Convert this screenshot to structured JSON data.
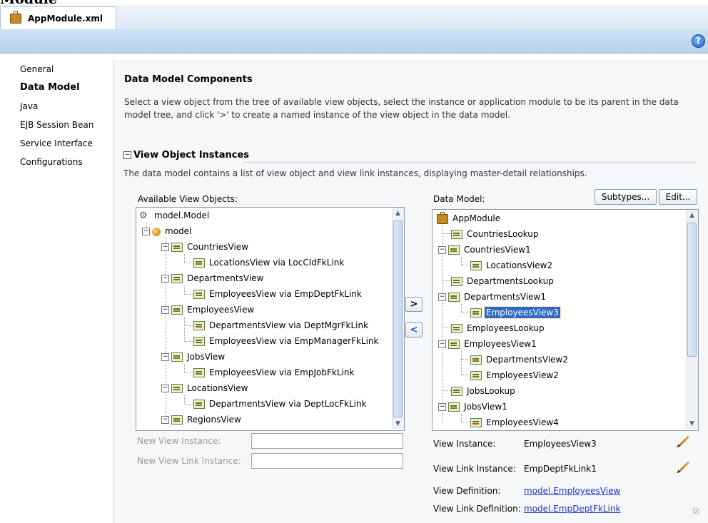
{
  "window": {
    "title_fragment": "Module"
  },
  "editor_tab": {
    "label": "AppModule.xml"
  },
  "toolbar": {
    "help_glyph": "?"
  },
  "nav": [
    {
      "label": "General"
    },
    {
      "label": "Data Model"
    },
    {
      "label": "Java"
    },
    {
      "label": "EJB Session Bean"
    },
    {
      "label": "Service Interface"
    },
    {
      "label": "Configurations"
    }
  ],
  "header": {
    "title": "Data Model Components",
    "description": "Select a view object from the tree of available view objects, select the instance or application module to be its parent in the data model tree, and click '>' to create a named instance of the view object in the data model."
  },
  "section": {
    "title": "View Object Instances",
    "description": "The data model contains a list of view object and view link instances, displaying master-detail relationships."
  },
  "available": {
    "label": "Available View Objects:",
    "items": [
      {
        "label": "model.Model",
        "icon": "gears-icon"
      },
      {
        "label": "model",
        "icon": "package-icon"
      },
      {
        "label": "CountriesView",
        "icon": "view-object-icon"
      },
      {
        "label": "LocationsView via LocCIdFkLink",
        "icon": "view-object-icon"
      },
      {
        "label": "DepartmentsView",
        "icon": "view-object-icon"
      },
      {
        "label": "EmployeesView via EmpDeptFkLink",
        "icon": "view-object-icon"
      },
      {
        "label": "EmployeesView",
        "icon": "view-object-icon"
      },
      {
        "label": "DepartmentsView via DeptMgrFkLink",
        "icon": "view-object-icon"
      },
      {
        "label": "EmployeesView via EmpManagerFkLink",
        "icon": "view-object-icon"
      },
      {
        "label": "JobsView",
        "icon": "view-object-icon"
      },
      {
        "label": "EmployeesView via EmpJobFkLink",
        "icon": "view-object-icon"
      },
      {
        "label": "LocationsView",
        "icon": "view-object-icon"
      },
      {
        "label": "DepartmentsView via DeptLocFkLink",
        "icon": "view-object-icon"
      },
      {
        "label": "RegionsView",
        "icon": "view-object-icon"
      }
    ]
  },
  "shuttle": {
    "add_label": ">",
    "remove_label": "<"
  },
  "datamodel": {
    "label": "Data Model:",
    "subtypes_button": "Subtypes...",
    "edit_button": "Edit...",
    "selected": "EmployeesView3",
    "items": [
      {
        "label": "AppModule",
        "icon": "app-module-icon"
      },
      {
        "label": "CountriesLookup",
        "icon": "view-instance-icon"
      },
      {
        "label": "CountriesView1",
        "icon": "view-instance-icon"
      },
      {
        "label": "LocationsView2",
        "icon": "view-instance-icon"
      },
      {
        "label": "DepartmentsLookup",
        "icon": "view-instance-icon"
      },
      {
        "label": "DepartmentsView1",
        "icon": "view-instance-icon"
      },
      {
        "label": "EmployeesView3",
        "icon": "view-instance-icon"
      },
      {
        "label": "EmployeesLookup",
        "icon": "view-instance-icon"
      },
      {
        "label": "EmployeesView1",
        "icon": "view-instance-icon"
      },
      {
        "label": "DepartmentsView2",
        "icon": "view-instance-icon"
      },
      {
        "label": "EmployeesView2",
        "icon": "view-instance-icon"
      },
      {
        "label": "JobsLookup",
        "icon": "view-instance-icon"
      },
      {
        "label": "JobsView1",
        "icon": "view-instance-icon"
      },
      {
        "label": "EmployeesView4",
        "icon": "view-instance-icon"
      }
    ]
  },
  "fields": {
    "new_view_instance_label": "New View Instance:",
    "new_view_instance_value": "",
    "new_view_link_instance_label": "New View Link Instance:",
    "new_view_link_instance_value": ""
  },
  "details": {
    "view_instance_label": "View Instance:",
    "view_instance_value": "EmployeesView3",
    "view_link_instance_label": "View Link Instance:",
    "view_link_instance_value": "EmpDeptFkLink1",
    "view_definition_label": "View Definition:",
    "view_definition_value": "model.EmployeesView",
    "view_link_definition_label": "View Link Definition:",
    "view_link_definition_value": "model.EmpDeptFkLink"
  },
  "colors": {
    "selection": "#316ac5",
    "link": "#1a38c9",
    "toolbar": "#c3daf0"
  }
}
